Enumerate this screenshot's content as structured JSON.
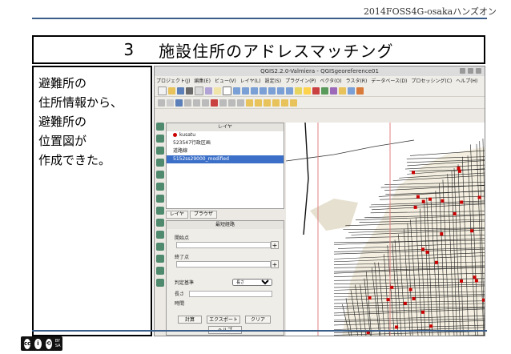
{
  "header": {
    "conference": "2014FOSS4G-osakaハンズオン"
  },
  "slide": {
    "number": "3",
    "title": "施設住所のアドレスマッチング"
  },
  "side_text": [
    "避難所の",
    "住所情報から、",
    "避難所の",
    "位置図が",
    "作成できた。"
  ],
  "qgis": {
    "window_title": "QGIS2.2.0-Valmiera - QGISgeoreference01",
    "menu": [
      "プロジェクト(J)",
      "編集(E)",
      "ビュー(V)",
      "レイヤ(L)",
      "設定(S)",
      "プラグイン(P)",
      "ベクタ(O)",
      "ラスタ(R)",
      "データベース(D)",
      "プロセッシング(C)",
      "ヘルプ(H)"
    ],
    "layers_panel": {
      "title": "レイヤ",
      "layers": [
        "kusatu",
        "523547行政区画",
        "道路線",
        "5152ss29000_modified"
      ]
    },
    "tabs": [
      "レイヤ",
      "ブラウザ"
    ],
    "route_panel": {
      "title": "最短経路",
      "start_label": "開始点",
      "end_label": "終了点",
      "criterion_label": "判定基準",
      "criterion_value": "長さ",
      "length_label": "長さ",
      "time_label": "時間",
      "buttons": {
        "calculate": "計算",
        "export": "エクスポート",
        "clear": "クリア"
      },
      "help": "ヘルプ"
    }
  },
  "license": {
    "badge_text": "BY SA"
  },
  "colors": {
    "accent_line": "#3a5d8a",
    "selected_layer": "#3b6fc8",
    "marker": "#cc0000"
  }
}
